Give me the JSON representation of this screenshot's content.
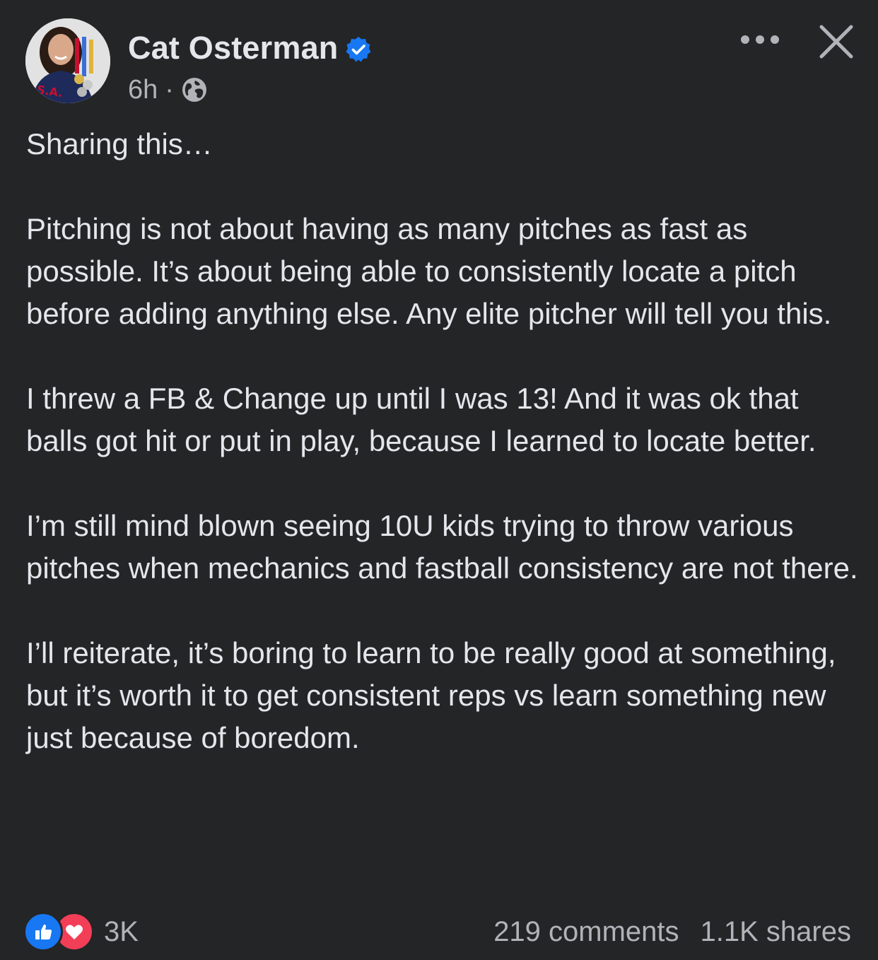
{
  "post": {
    "author": "Cat Osterman",
    "time": "6h",
    "separator": "·",
    "paragraphs": [
      "Sharing this…",
      "Pitching is not about having as many pitches as fast as possible. It’s about being able to consistently locate a pitch before adding anything else. Any elite pitcher will tell you this.",
      "I threw a FB & Change up until I was 13! And it was ok that balls got hit or put in play, because I learned to locate better.",
      "I’m still mind blown seeing 10U kids trying to throw various pitches when mechanics and fastball consistency are not there.",
      "I’ll reiterate, it’s boring to learn to be really good at something, but it’s worth it to get consistent reps vs learn something new just because of boredom."
    ],
    "reaction_count": "3K",
    "comments": "219 comments",
    "shares": "1.1K shares"
  },
  "icons": {
    "verified": "verified-badge-icon",
    "audience": "globe-icon",
    "more": "more-options-icon",
    "close": "close-icon",
    "like": "like-reaction-icon",
    "love": "love-reaction-icon"
  },
  "colors": {
    "background": "#242526",
    "text_primary": "#e4e6eb",
    "text_secondary": "#b0b3b8",
    "verified_blue": "#1877f2",
    "like_blue": "#1877f2",
    "love_red": "#f33e58"
  }
}
